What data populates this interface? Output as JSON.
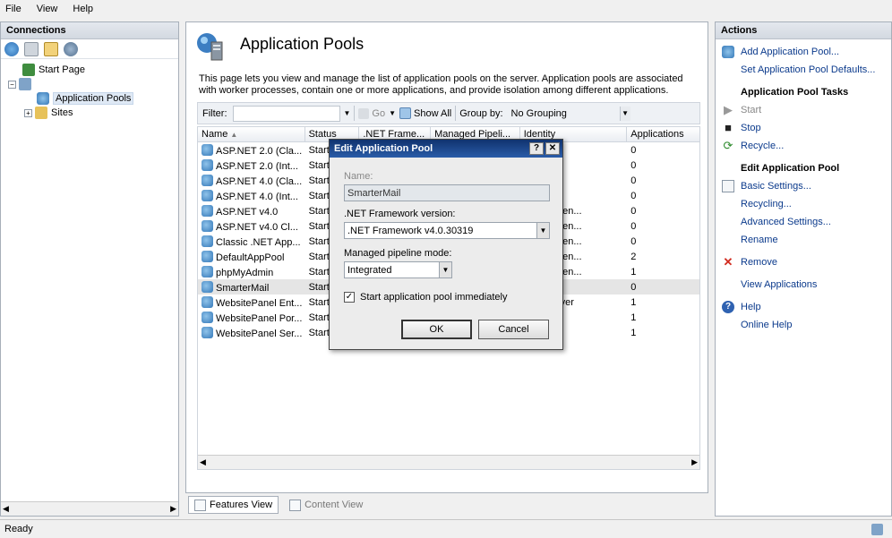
{
  "menu": [
    "File",
    "View",
    "Help"
  ],
  "connections": {
    "title": "Connections",
    "tree": {
      "start_page": "Start Page",
      "server": "",
      "app_pools": "Application Pools",
      "sites": "Sites",
      "sites_expander": "+"
    }
  },
  "main": {
    "title": "Application Pools",
    "description": "This page lets you view and manage the list of application pools on the server. Application pools are associated with worker processes, contain one or more applications, and provide isolation among different applications.",
    "filter_label": "Filter:",
    "go_label": "Go",
    "show_all_label": "Show All",
    "group_by_label": "Group by:",
    "group_by_value": "No Grouping",
    "columns": [
      "Name",
      "Status",
      ".NET Frame...",
      "Managed Pipeli...",
      "Identity",
      "Applications"
    ],
    "rows": [
      {
        "name": "ASP.NET 2.0 (Cla...",
        "status": "Start",
        "identity": "Service",
        "apps": "0"
      },
      {
        "name": "ASP.NET 2.0 (Int...",
        "status": "Start",
        "identity": "Service",
        "apps": "0"
      },
      {
        "name": "ASP.NET 4.0 (Cla...",
        "status": "Start",
        "identity": "Service",
        "apps": "0"
      },
      {
        "name": "ASP.NET 4.0 (Int...",
        "status": "Start",
        "identity": "Service",
        "apps": "0"
      },
      {
        "name": "ASP.NET v4.0",
        "status": "Start",
        "identity": "onPoolIden...",
        "apps": "0"
      },
      {
        "name": "ASP.NET v4.0 Cl...",
        "status": "Start",
        "identity": "onPoolIden...",
        "apps": "0"
      },
      {
        "name": "Classic .NET App...",
        "status": "Start",
        "identity": "onPoolIden...",
        "apps": "0"
      },
      {
        "name": "DefaultAppPool",
        "status": "Start",
        "identity": "onPoolIden...",
        "apps": "2"
      },
      {
        "name": "phpMyAdmin",
        "status": "Start",
        "identity": "onPoolIden...",
        "apps": "1"
      },
      {
        "name": "SmarterMail",
        "status": "Start",
        "identity": "Service",
        "apps": "0"
      },
      {
        "name": "WebsitePanel Ent...",
        "status": "Start",
        "identity": "priseServer",
        "apps": "1"
      },
      {
        "name": "WebsitePanel Por...",
        "status": "Start",
        "identity": "",
        "apps": "1"
      },
      {
        "name": "WebsitePanel Ser...",
        "status": "Start",
        "identity": "r",
        "apps": "1"
      }
    ]
  },
  "views": {
    "features": "Features View",
    "content": "Content View"
  },
  "actions": {
    "title": "Actions",
    "add_pool": "Add Application Pool...",
    "set_defaults": "Set Application Pool Defaults...",
    "tasks_header": "Application Pool Tasks",
    "start": "Start",
    "stop": "Stop",
    "recycle": "Recycle...",
    "edit_header": "Edit Application Pool",
    "basic_settings": "Basic Settings...",
    "recycling": "Recycling...",
    "advanced_settings": "Advanced Settings...",
    "rename": "Rename",
    "remove": "Remove",
    "view_apps": "View Applications",
    "help": "Help",
    "online_help": "Online Help"
  },
  "dialog": {
    "title": "Edit Application Pool",
    "help_btn": "?",
    "close_btn": "✕",
    "name_label": "Name:",
    "name_value": "SmarterMail",
    "framework_label": ".NET Framework version:",
    "framework_value": ".NET Framework v4.0.30319",
    "pipeline_label": "Managed pipeline mode:",
    "pipeline_value": "Integrated",
    "start_immediately_label": "Start application pool immediately",
    "start_immediately_checked": "✓",
    "ok": "OK",
    "cancel": "Cancel"
  },
  "status": {
    "text": "Ready"
  }
}
